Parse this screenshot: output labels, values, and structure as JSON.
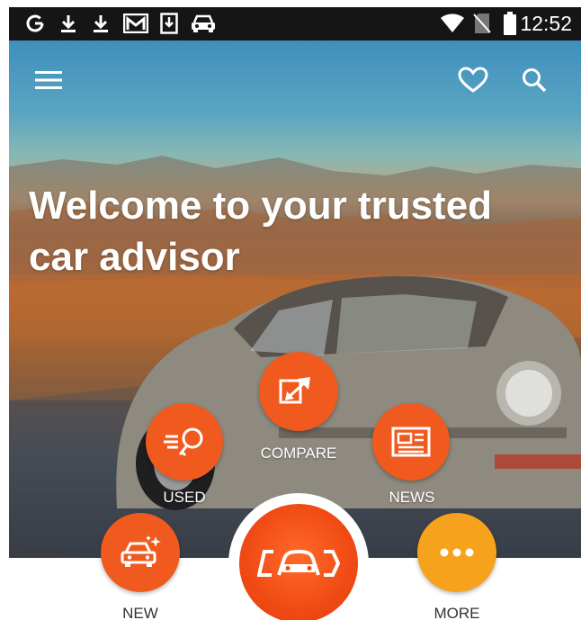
{
  "status_bar": {
    "time": "12:52",
    "left_icons": [
      "g-icon",
      "download-icon",
      "download-icon",
      "gmail-icon",
      "download-box-icon",
      "car-icon"
    ],
    "right_icons": [
      "wifi-icon",
      "no-sim-icon",
      "battery-icon"
    ]
  },
  "app_bar": {
    "menu_icon": "hamburger-menu-icon",
    "favorites_icon": "heart-icon",
    "search_icon": "search-icon"
  },
  "hero": {
    "headline_line1": "Welcome to your trusted",
    "headline_line2": "car advisor"
  },
  "actions": {
    "compare": {
      "label": "COMPARE",
      "icon": "compare-arrows-icon"
    },
    "used": {
      "label": "USED",
      "icon": "used-key-icon"
    },
    "news": {
      "label": "NEWS",
      "icon": "newspaper-icon"
    },
    "new": {
      "label": "NEW",
      "icon": "new-car-sparkle-icon"
    },
    "more": {
      "label": "MORE",
      "icon": "more-dots-icon"
    },
    "home": {
      "icon": "cardekho-logo-icon"
    }
  },
  "colors": {
    "accent_orange": "#f05a1e",
    "accent_yellow": "#f6a21c",
    "status_bar": "#151515"
  }
}
